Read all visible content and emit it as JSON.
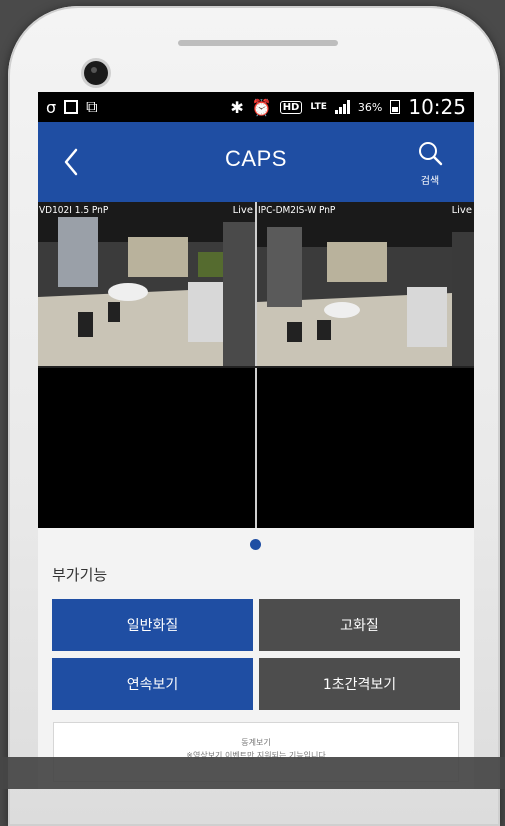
{
  "statusbar": {
    "left_icons": [
      "o-logo-icon",
      "image-icon",
      "gallery-icon"
    ],
    "battery_percent": "36%",
    "time": "10:25",
    "hd_label": "HD",
    "network": "LTE"
  },
  "appbar": {
    "title": "CAPS",
    "search_label": "검색"
  },
  "cameras": [
    {
      "name": "VD102I 1.5 PnP",
      "status": "Live"
    },
    {
      "name": "IPC-DM2IS-W PnP",
      "status": "Live"
    },
    {
      "name": "",
      "status": ""
    },
    {
      "name": "",
      "status": ""
    }
  ],
  "pager": {
    "current": 1,
    "total": 1
  },
  "extra": {
    "section_title": "부가기능",
    "buttons": {
      "normal_quality": "일반화질",
      "high_quality": "고화질",
      "continuous_view": "연속보기",
      "one_sec_interval": "1초간격보기"
    },
    "card": {
      "title": "동계보기",
      "desc": "※영상보기 이벤트만 지원되는 기능입니다"
    }
  },
  "colors": {
    "primary": "#1f4ea3",
    "secondary_button": "#4d4d4d",
    "background": "#f3f3f3"
  }
}
